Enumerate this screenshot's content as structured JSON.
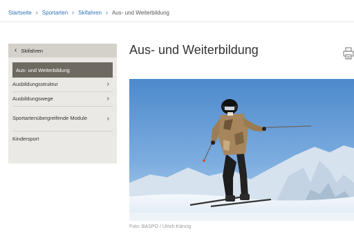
{
  "breadcrumb": {
    "items": [
      "Startseite",
      "Sportarten",
      "Skifahren"
    ],
    "current": "Aus- und Weiterbildung",
    "separator": "›"
  },
  "sidebar": {
    "back_label": "Skifahren",
    "active_label": "Aus- und Weiterbildung",
    "items": [
      {
        "label": "Ausbildungsstruktur",
        "has_submenu": true
      },
      {
        "label": "Ausbildungswege",
        "has_submenu": true
      },
      {
        "label": "Sportartenübergreifende Module",
        "has_submenu": true
      },
      {
        "label": "Kindersport",
        "has_submenu": false
      }
    ]
  },
  "main": {
    "title": "Aus- und Weiterbildung",
    "image_caption": "Foto: BASPO / Ulrich Känzig"
  },
  "icons": {
    "back": "chevron-left-icon",
    "submenu": "chevron-right-icon",
    "print": "printer-icon"
  },
  "colors": {
    "link": "#2d73b5",
    "sidebar_bg": "#ebe9e5",
    "sidebar_header": "#d4d1cb",
    "sidebar_active": "#6e6961"
  }
}
